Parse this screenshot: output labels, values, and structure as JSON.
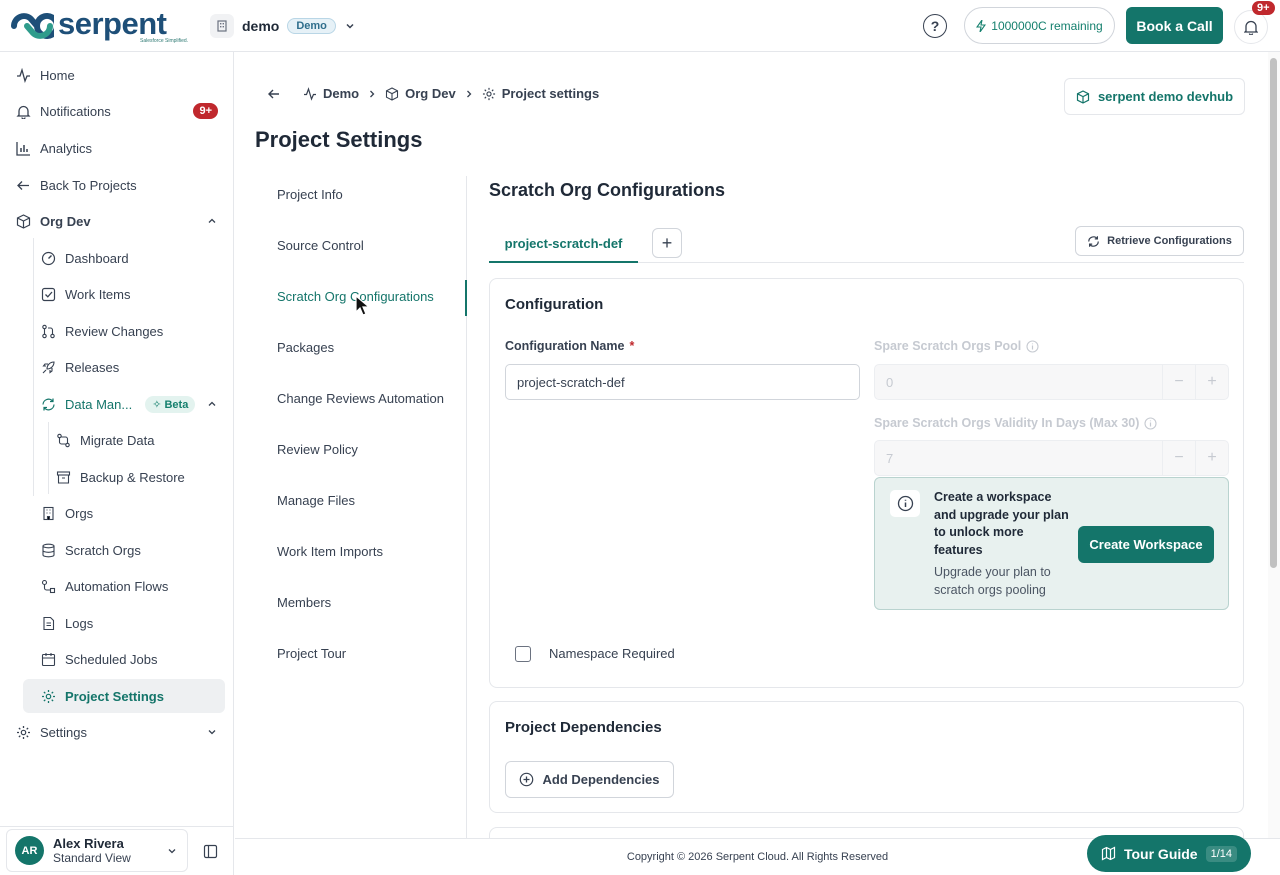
{
  "brand": {
    "name": "serpent",
    "tagline": "Salesforce Simplified."
  },
  "header": {
    "workspace_name": "demo",
    "workspace_badge": "Demo",
    "credits": "1000000C remaining",
    "book_call": "Book a Call",
    "notifications_badge": "9+"
  },
  "sidebar": {
    "home": "Home",
    "notifications": "Notifications",
    "notifications_badge": "9+",
    "analytics": "Analytics",
    "back_to_projects": "Back To Projects",
    "org_dev": "Org Dev",
    "dashboard": "Dashboard",
    "work_items": "Work Items",
    "review_changes": "Review Changes",
    "releases": "Releases",
    "data_management": "Data Man...",
    "beta_badge": "Beta",
    "migrate_data": "Migrate Data",
    "backup_restore": "Backup & Restore",
    "orgs": "Orgs",
    "scratch_orgs": "Scratch Orgs",
    "automation_flows": "Automation Flows",
    "logs": "Logs",
    "scheduled_jobs": "Scheduled Jobs",
    "project_settings": "Project Settings",
    "settings": "Settings"
  },
  "user": {
    "initials": "AR",
    "name": "Alex Rivera",
    "role": "Standard View"
  },
  "breadcrumb": {
    "demo": "Demo",
    "org_dev": "Org Dev",
    "project_settings": "Project settings"
  },
  "org_button": "serpent demo devhub",
  "page_title": "Project Settings",
  "settings_nav": [
    "Project Info",
    "Source Control",
    "Scratch Org Configurations",
    "Packages",
    "Change Reviews Automation",
    "Review Policy",
    "Manage Files",
    "Work Item Imports",
    "Members",
    "Project Tour"
  ],
  "section_title": "Scratch Org Configurations",
  "tab_label": "project-scratch-def",
  "tab_add": "+",
  "retrieve_button": "Retrieve Configurations",
  "configuration": {
    "title": "Configuration",
    "name_label": "Configuration Name",
    "required_mark": "*",
    "name_value": "project-scratch-def",
    "pool_label": "Spare Scratch Orgs Pool",
    "pool_value": "0",
    "validity_label": "Spare Scratch Orgs Validity In Days (Max 30)",
    "validity_value": "7",
    "upsell_heading": "Create a workspace and upgrade your plan to unlock more features",
    "upsell_sub": "Upgrade your plan to scratch orgs pooling",
    "create_workspace": "Create Workspace",
    "namespace_label": "Namespace Required"
  },
  "dependencies": {
    "title": "Project Dependencies",
    "add_button": "Add Dependencies"
  },
  "footer": {
    "copyright": "Copyright © 2026 Serpent Cloud. All Rights Reserved"
  },
  "tour": {
    "label": "Tour Guide",
    "count": "1/14"
  }
}
